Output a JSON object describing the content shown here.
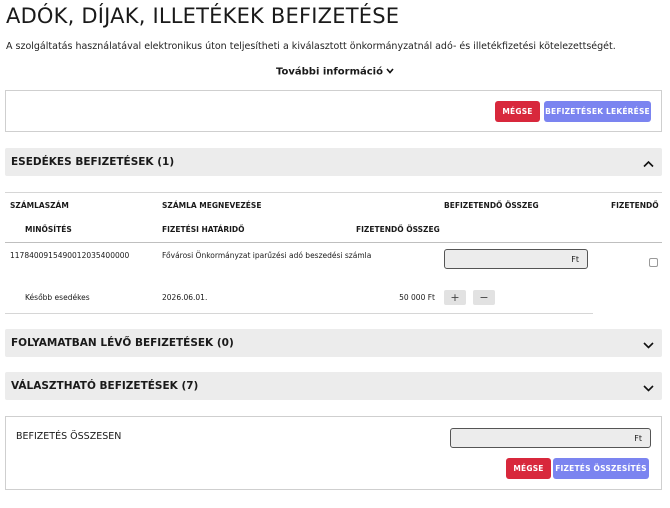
{
  "page": {
    "title": "ADÓK, DÍJAK, ILLETÉKEK BEFIZETÉSE",
    "subtitle": "A szolgáltatás használatával elektronikus úton teljesítheti a kiválasztott önkormányzatnál adó- és illetékfizetési kötelezettségét.",
    "more_info": "További információ"
  },
  "top_actions": {
    "cancel_label": "MÉGSE",
    "fetch_label": "BEFIZETÉSEK LEKÉRÉSE"
  },
  "due_section": {
    "title": "ESEDÉKES BEFIZETÉSEK (1)",
    "headers": {
      "account_number": "SZÁMLASZÁM",
      "account_name": "SZÁMLA MEGNEVEZÉSE",
      "amount_to_pay": "BEFIZETENDŐ ÖSSZEG",
      "payable": "FIZETENDŐ",
      "qualification": "MINŐSÍTÉS",
      "payment_deadline": "FIZETÉSI HATÁRIDŐ",
      "payable_amount": "FIZETENDŐ ÖSSZEG"
    },
    "row": {
      "account_number": "11784009154900120354000​00",
      "account_name": "Fővárosi Önkormányzat iparűzési adó beszedési számla",
      "amount_input": "Ft",
      "qualification": "Később esedékes",
      "deadline": "2026.06.01.",
      "amount": "50 000 Ft",
      "plus": "+",
      "minus": "−"
    }
  },
  "in_progress_section": {
    "title": "FOLYAMATBAN LÉVŐ BEFIZETÉSEK (0)"
  },
  "selectable_section": {
    "title": "VÁLASZTHATÓ BEFIZETÉSEK (7)"
  },
  "total": {
    "label": "BEFIZETÉS ÖSSZESEN",
    "amount_input": "Ft",
    "cancel_label": "MÉGSE",
    "summary_label": "FIZETÉS ÖSSZESÍTÉS"
  }
}
